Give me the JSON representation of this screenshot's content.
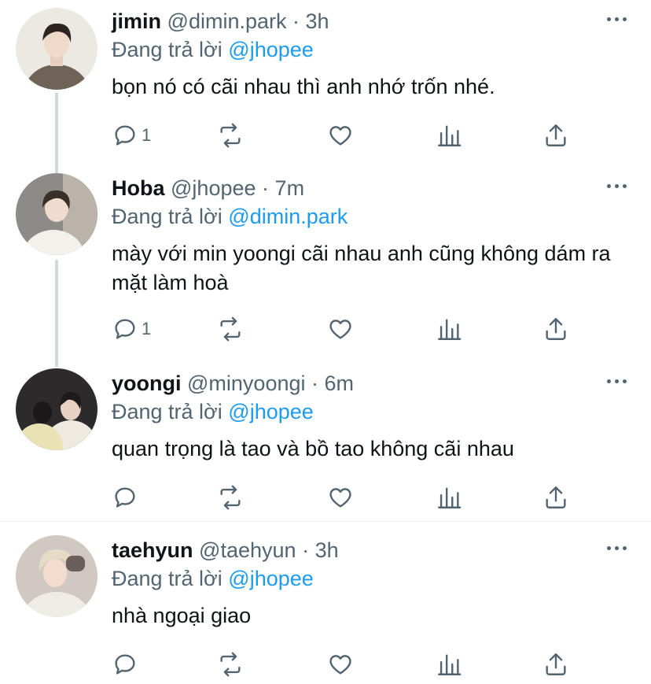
{
  "replies": [
    {
      "name": "jimin",
      "handle": "@dimin.park",
      "time": "3h",
      "replying_label": "Đang trả lời",
      "replying_to": "@jhopee",
      "text": "bọn nó có cãi nhau thì anh nhớ trốn nhé.",
      "reply_count": "1"
    },
    {
      "name": "Hoba",
      "handle": "@jhopee",
      "time": "7m",
      "replying_label": "Đang trả lời",
      "replying_to": "@dimin.park",
      "text": "mày với min yoongi cãi nhau anh cũng không dám ra mặt làm hoà",
      "reply_count": "1"
    },
    {
      "name": "yoongi",
      "handle": "@minyoongi",
      "time": "6m",
      "replying_label": "Đang trả lời",
      "replying_to": "@jhopee",
      "text": "quan trọng là tao và bồ tao không cãi nhau",
      "reply_count": ""
    },
    {
      "name": "taehyun",
      "handle": "@taehyun",
      "time": "3h",
      "replying_label": "Đang trả lời",
      "replying_to": "@jhopee",
      "text": "nhà ngoại giao",
      "reply_count": ""
    }
  ],
  "separator": "·",
  "colors": {
    "mention": "#1d9bf0",
    "meta": "#536471",
    "thread_line": "#cfd9de"
  }
}
